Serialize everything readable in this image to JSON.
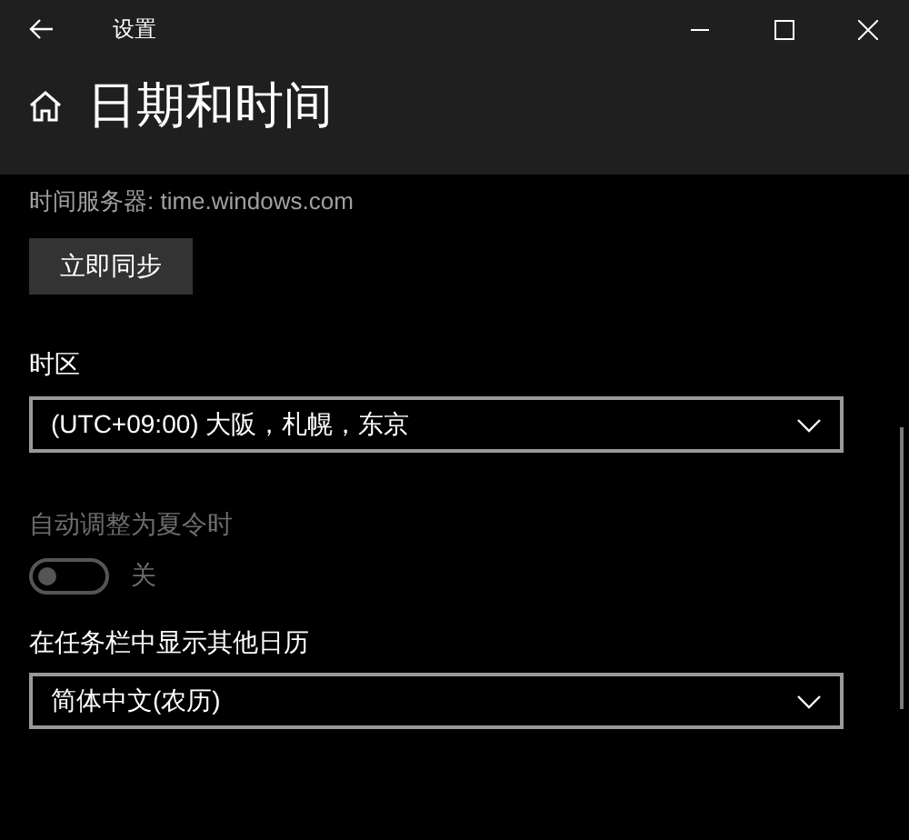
{
  "window": {
    "title": "设置"
  },
  "page": {
    "title": "日期和时间"
  },
  "time_server": "时间服务器: time.windows.com",
  "sync_button": "立即同步",
  "time_zone": {
    "label": "时区",
    "value": "(UTC+09:00) 大阪，札幌，东京"
  },
  "dst": {
    "label": "自动调整为夏令时",
    "on": false,
    "disabled": true,
    "state_text": "关"
  },
  "calendar": {
    "label": "在任务栏中显示其他日历",
    "value": "简体中文(农历)"
  }
}
